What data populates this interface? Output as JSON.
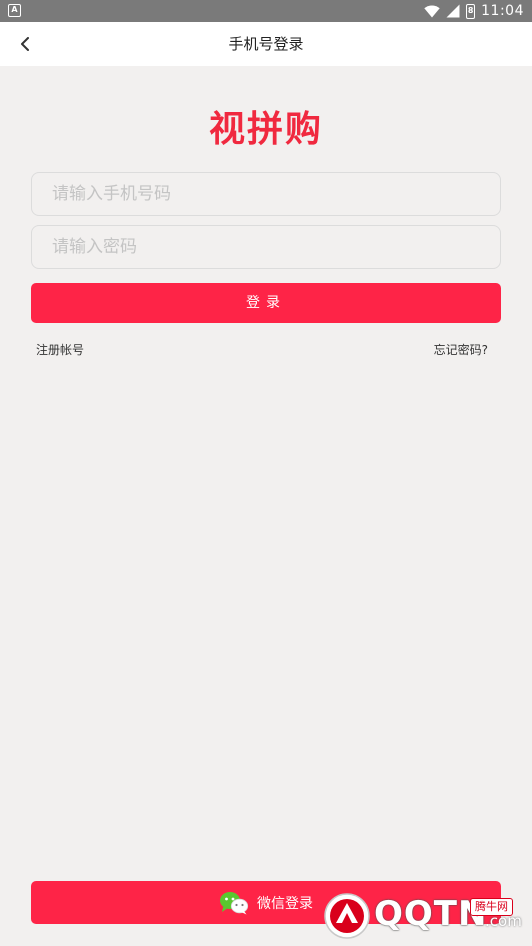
{
  "status_bar": {
    "time": "11:04",
    "battery_level": "8",
    "app_icon_letter": "A"
  },
  "header": {
    "title": "手机号登录"
  },
  "logo_text": "视拼购",
  "form": {
    "phone_placeholder": "请输入手机号码",
    "password_placeholder": "请输入密码",
    "login_label": "登录"
  },
  "links": {
    "register": "注册帐号",
    "forgot": "忘记密码?"
  },
  "wechat": {
    "label": "微信登录"
  },
  "watermark": {
    "brand": "QQTN",
    "suffix": ".com",
    "badge": "腾牛网"
  },
  "colors": {
    "accent": "#fe2447",
    "logo": "#f0293f",
    "background": "#f2f0ef",
    "status_bar": "#7a7a7a"
  }
}
